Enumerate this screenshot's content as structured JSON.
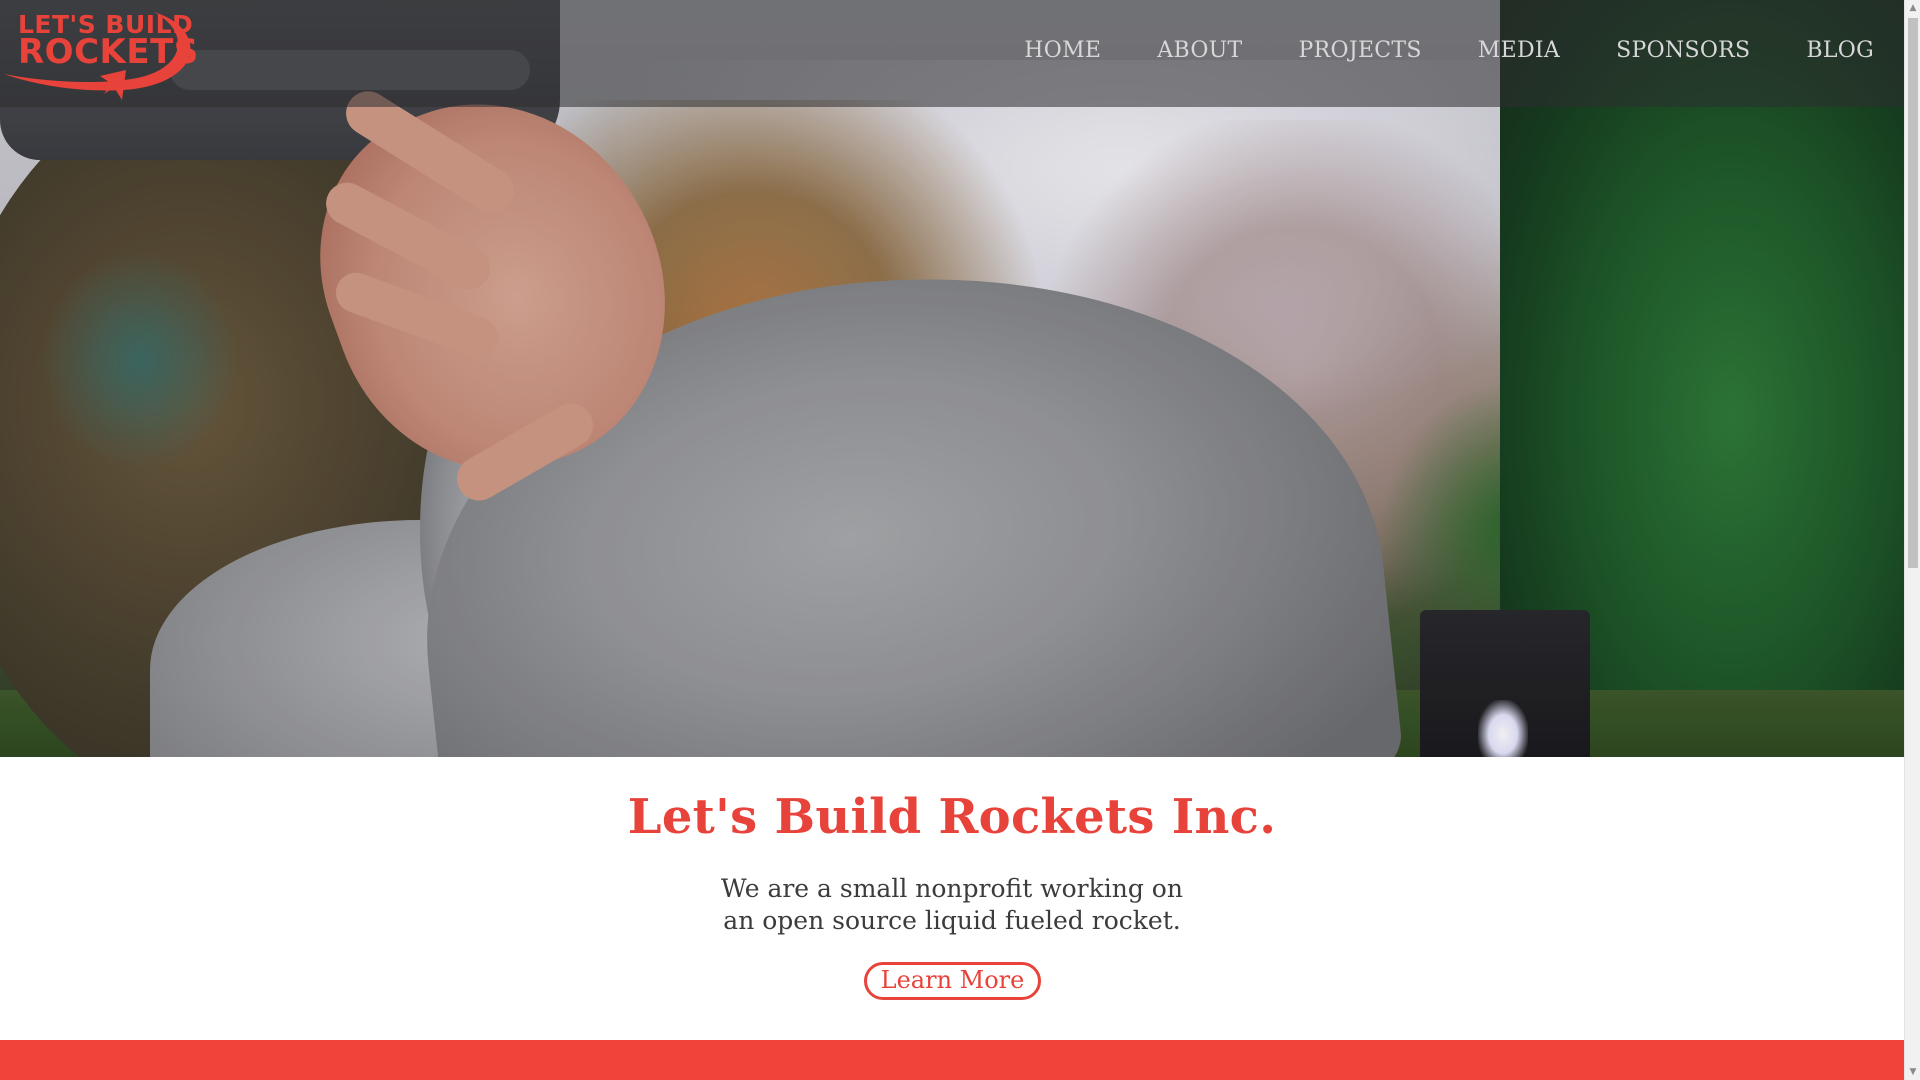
{
  "logo": {
    "line1": "LET'S BUILD",
    "line2": "ROCKETS",
    "icon": "rocket-swoosh-logo"
  },
  "nav": {
    "items": [
      {
        "label": "HOME"
      },
      {
        "label": "ABOUT"
      },
      {
        "label": "PROJECTS"
      },
      {
        "label": "MEDIA"
      },
      {
        "label": "SPONSORS"
      },
      {
        "label": "BLOG"
      }
    ]
  },
  "intro": {
    "title": "Let's Build Rockets Inc.",
    "desc_line1": "We are a small nonprofit working on",
    "desc_line2": "an open source liquid fueled rocket.",
    "cta_label": "Learn More"
  },
  "scrollbar": {
    "up_icon": "arrow-up-icon",
    "down_icon": "arrow-down-icon"
  },
  "colors": {
    "accent": "#e8433a",
    "band": "#f2433a",
    "nav_text": "#d7d7d9",
    "body_text": "#3c3c3c"
  }
}
